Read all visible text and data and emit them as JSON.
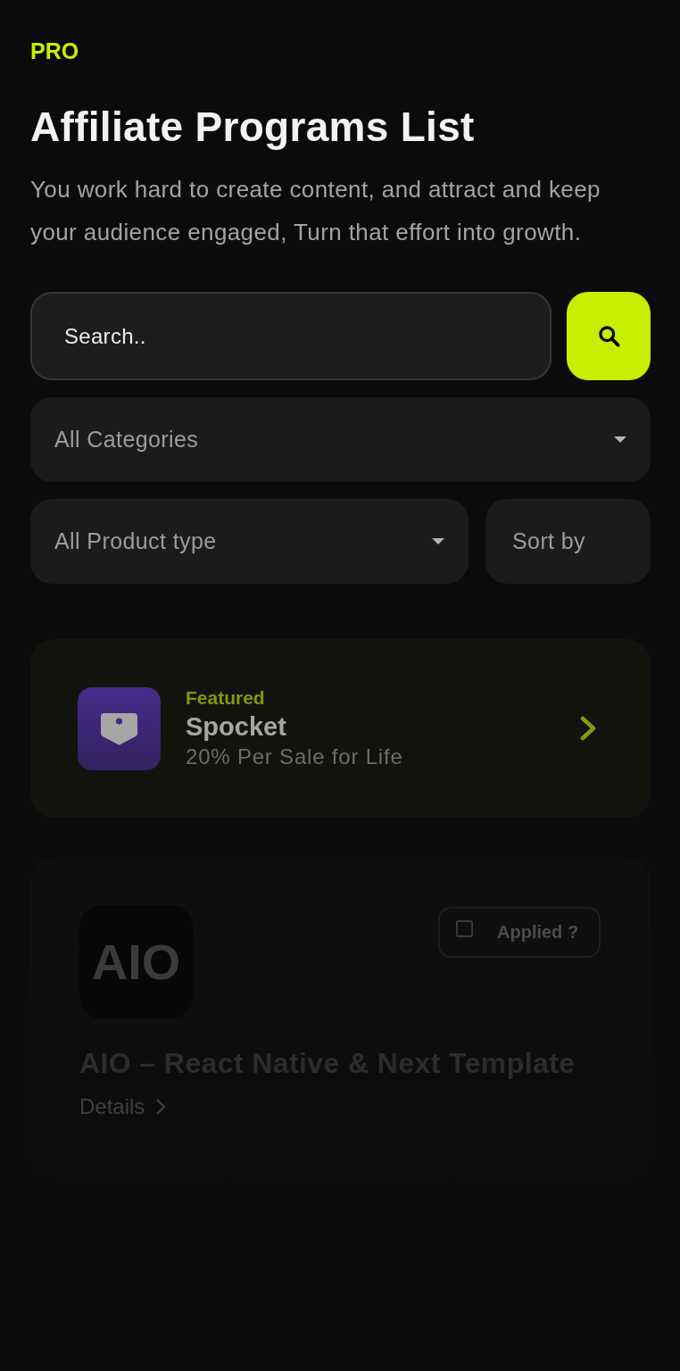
{
  "header": {
    "badge": "PRO",
    "title": "Affiliate Programs List",
    "description": "You work hard to create content, and attract and keep your audience engaged, Turn that effort into growth."
  },
  "search": {
    "placeholder": "Search.."
  },
  "filters": [
    {
      "kind": "dropdown",
      "value": "All Categories"
    },
    {
      "kind": "dropdown",
      "value": "All Product type"
    },
    {
      "kind": "plain",
      "value": "Sort by"
    }
  ],
  "featured": {
    "tag": "Featured",
    "name": "Spocket",
    "commission": "20% Per Sale for Life"
  },
  "programs": [
    {
      "logo_text": "AIO",
      "applied_label": "Applied ?",
      "applied": false,
      "title": "AIO – React Native & Next Template",
      "link": "Details"
    }
  ]
}
